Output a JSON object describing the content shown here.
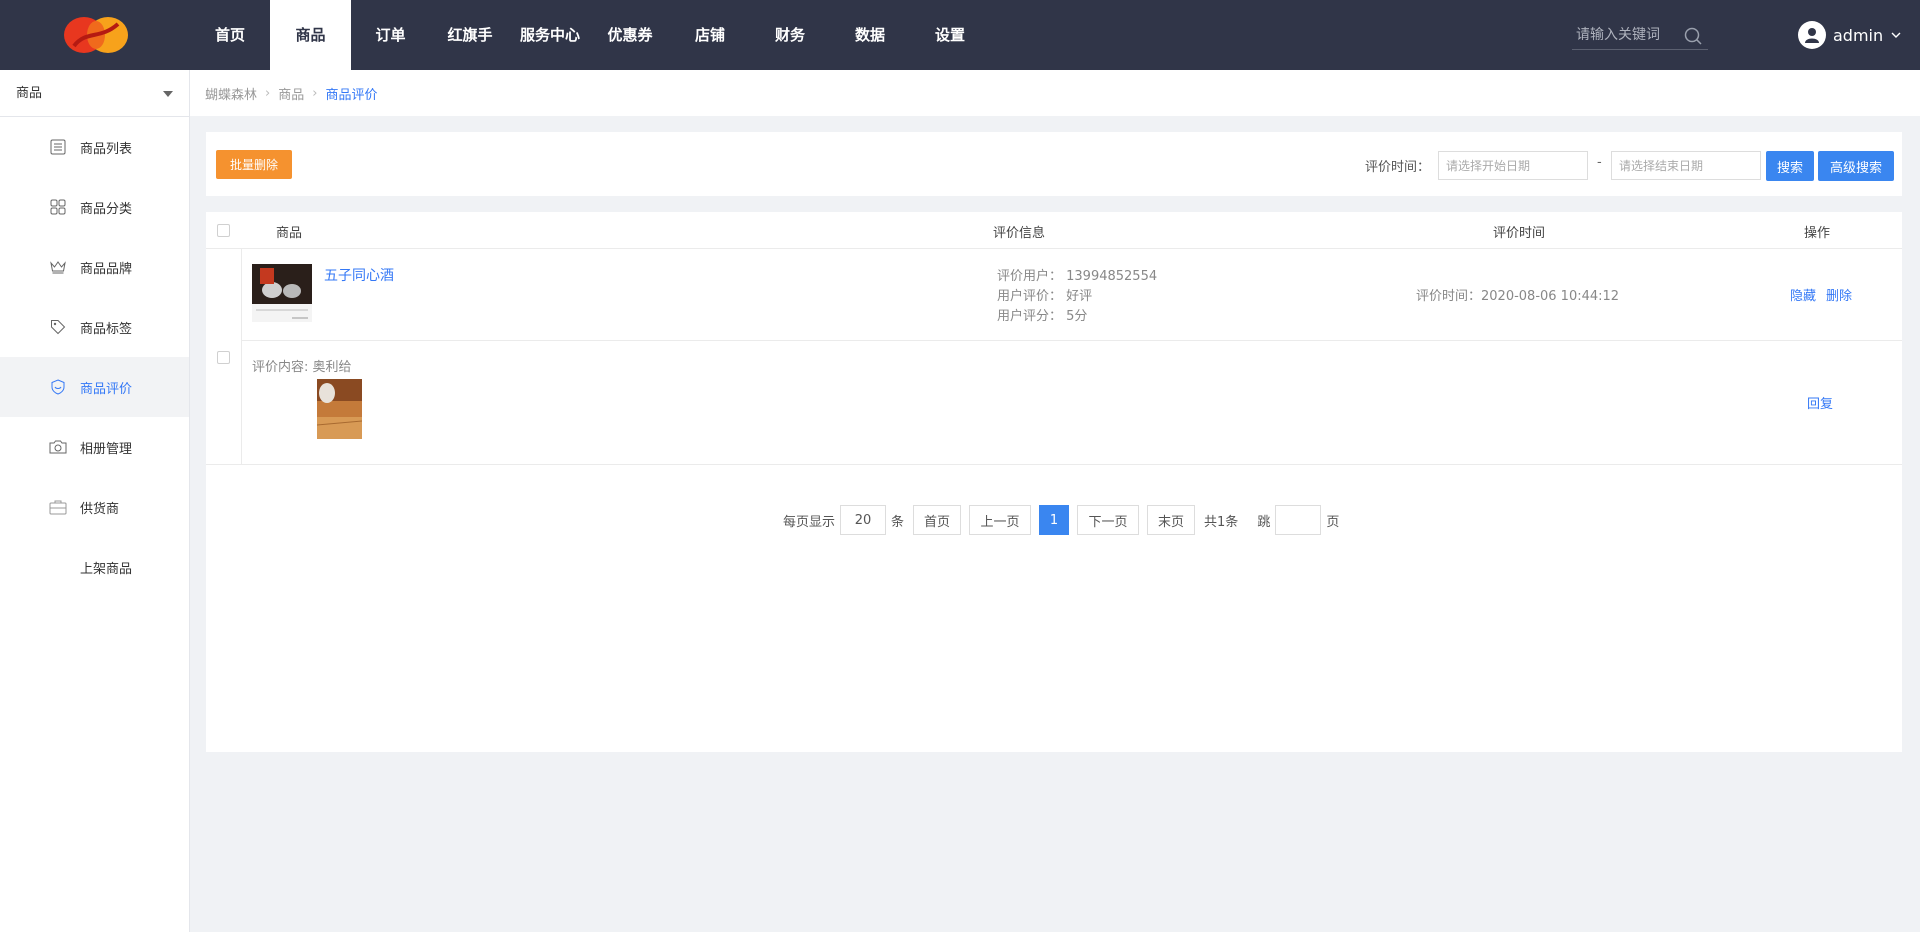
{
  "header": {
    "nav": [
      {
        "label": "首页",
        "active": false
      },
      {
        "label": "商品",
        "active": true
      },
      {
        "label": "订单",
        "active": false
      },
      {
        "label": "红旗手",
        "active": false
      },
      {
        "label": "服务中心",
        "active": false
      },
      {
        "label": "优惠券",
        "active": false
      },
      {
        "label": "店铺",
        "active": false
      },
      {
        "label": "财务",
        "active": false
      },
      {
        "label": "数据",
        "active": false
      },
      {
        "label": "设置",
        "active": false
      }
    ],
    "search_placeholder": "请输入关键词",
    "username": "admin"
  },
  "sidebar": {
    "module_select": "商品",
    "items": [
      {
        "label": "商品列表",
        "icon": "list-icon",
        "active": false
      },
      {
        "label": "商品分类",
        "icon": "grid-icon",
        "active": false
      },
      {
        "label": "商品品牌",
        "icon": "crown-icon",
        "active": false
      },
      {
        "label": "商品标签",
        "icon": "tag-icon",
        "active": false
      },
      {
        "label": "商品评价",
        "icon": "shield-icon",
        "active": true
      },
      {
        "label": "相册管理",
        "icon": "camera-icon",
        "active": false
      },
      {
        "label": "供货商",
        "icon": "briefcase-icon",
        "active": false
      },
      {
        "label": "上架商品",
        "icon": "",
        "active": false
      }
    ]
  },
  "breadcrumb": {
    "items": [
      "蝴蝶森林",
      "商品",
      "商品评价"
    ]
  },
  "filter": {
    "batch_delete": "批量删除",
    "time_label": "评价时间：",
    "start_placeholder": "请选择开始日期",
    "dash": "-",
    "end_placeholder": "请选择结束日期",
    "search": "搜索",
    "advanced_search": "高级搜索"
  },
  "table": {
    "headers": {
      "goods": "商品",
      "info": "评价信息",
      "time": "评价时间",
      "ops": "操作"
    },
    "rows": [
      {
        "goods_name": "五子同心酒",
        "eval_user": "评价用户： 13994852554",
        "user_rating": "用户评价： 好评",
        "user_score": "用户评分： 5分",
        "eval_time": "评价时间：2020-08-06 10:44:12",
        "hide": "隐藏",
        "delete": "删除",
        "content": "评价内容: 奥利给",
        "reply": "回复"
      }
    ]
  },
  "pager": {
    "per_page_label": "每页显示",
    "per_page": "20",
    "per_page_unit": "条",
    "first": "首页",
    "prev": "上一页",
    "current": "1",
    "next": "下一页",
    "last": "末页",
    "total": "共1条",
    "jump_label": "跳",
    "page_unit": "页"
  },
  "colors": {
    "topbar": "#303548",
    "accent": "#3478f6",
    "orange": "#f5922f"
  }
}
